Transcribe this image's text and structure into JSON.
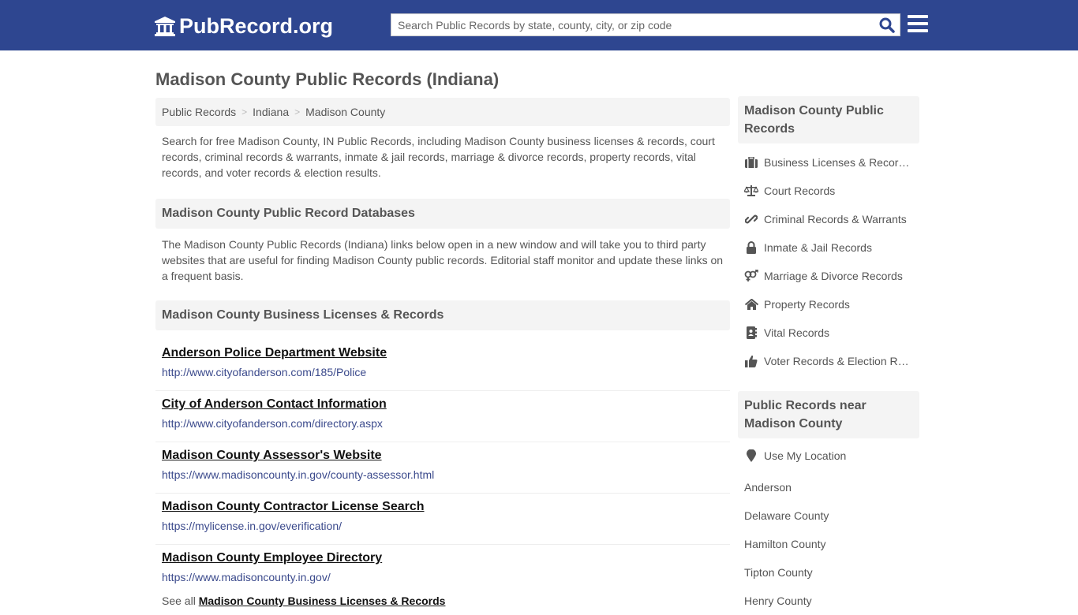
{
  "header": {
    "logo_text": "PubRecord.org",
    "search_placeholder": "Search Public Records by state, county, city, or zip code",
    "search_value": "",
    "colors": {
      "brand": "#2e4690",
      "search_icon": "#2e4690"
    }
  },
  "page": {
    "title": "Madison County Public Records (Indiana)"
  },
  "breadcrumb": [
    {
      "label": "Public Records"
    },
    {
      "label": "Indiana"
    },
    {
      "label": "Madison County"
    }
  ],
  "breadcrumb_separator": ">",
  "intro": "Search for free Madison County, IN Public Records, including Madison County business licenses & records, court records, criminal records & warrants, inmate & jail records, marriage & divorce records, property records, vital records, and voter records & election results.",
  "databases": {
    "heading": "Madison County Public Record Databases",
    "text": "The Madison County Public Records (Indiana) links below open in a new window and will take you to third party websites that are useful for finding Madison County public records. Editorial staff monitor and update these links on a frequent basis."
  },
  "business": {
    "heading": "Madison County Business Licenses & Records",
    "links": [
      {
        "title": "Anderson Police Department Website",
        "url": "http://www.cityofanderson.com/185/Police"
      },
      {
        "title": "City of Anderson Contact Information",
        "url": "http://www.cityofanderson.com/directory.aspx"
      },
      {
        "title": "Madison County Assessor's Website",
        "url": "https://www.madisoncounty.in.gov/county-assessor.html"
      },
      {
        "title": "Madison County Contractor License Search",
        "url": "https://mylicense.in.gov/everification/"
      },
      {
        "title": "Madison County Employee Directory",
        "url": "https://www.madisoncounty.in.gov/"
      }
    ],
    "see_all_prefix": "See all",
    "see_all_link": "Madison County Business Licenses & Records"
  },
  "sidebar": {
    "records_heading": "Madison County Public Records",
    "records": [
      {
        "icon": "briefcase-icon",
        "label": "Business Licenses & Records"
      },
      {
        "icon": "scale-icon",
        "label": "Court Records"
      },
      {
        "icon": "link-icon",
        "label": "Criminal Records & Warrants"
      },
      {
        "icon": "lock-icon",
        "label": "Inmate & Jail Records"
      },
      {
        "icon": "gender-icon",
        "label": "Marriage & Divorce Records"
      },
      {
        "icon": "home-icon",
        "label": "Property Records"
      },
      {
        "icon": "address-book-icon",
        "label": "Vital Records"
      },
      {
        "icon": "thumbs-up-icon",
        "label": "Voter Records & Election Results"
      }
    ],
    "near_heading": "Public Records near Madison County",
    "use_location": "Use My Location",
    "near": [
      {
        "label": "Anderson"
      },
      {
        "label": "Delaware County"
      },
      {
        "label": "Hamilton County"
      },
      {
        "label": "Tipton County"
      },
      {
        "label": "Henry County"
      }
    ]
  }
}
